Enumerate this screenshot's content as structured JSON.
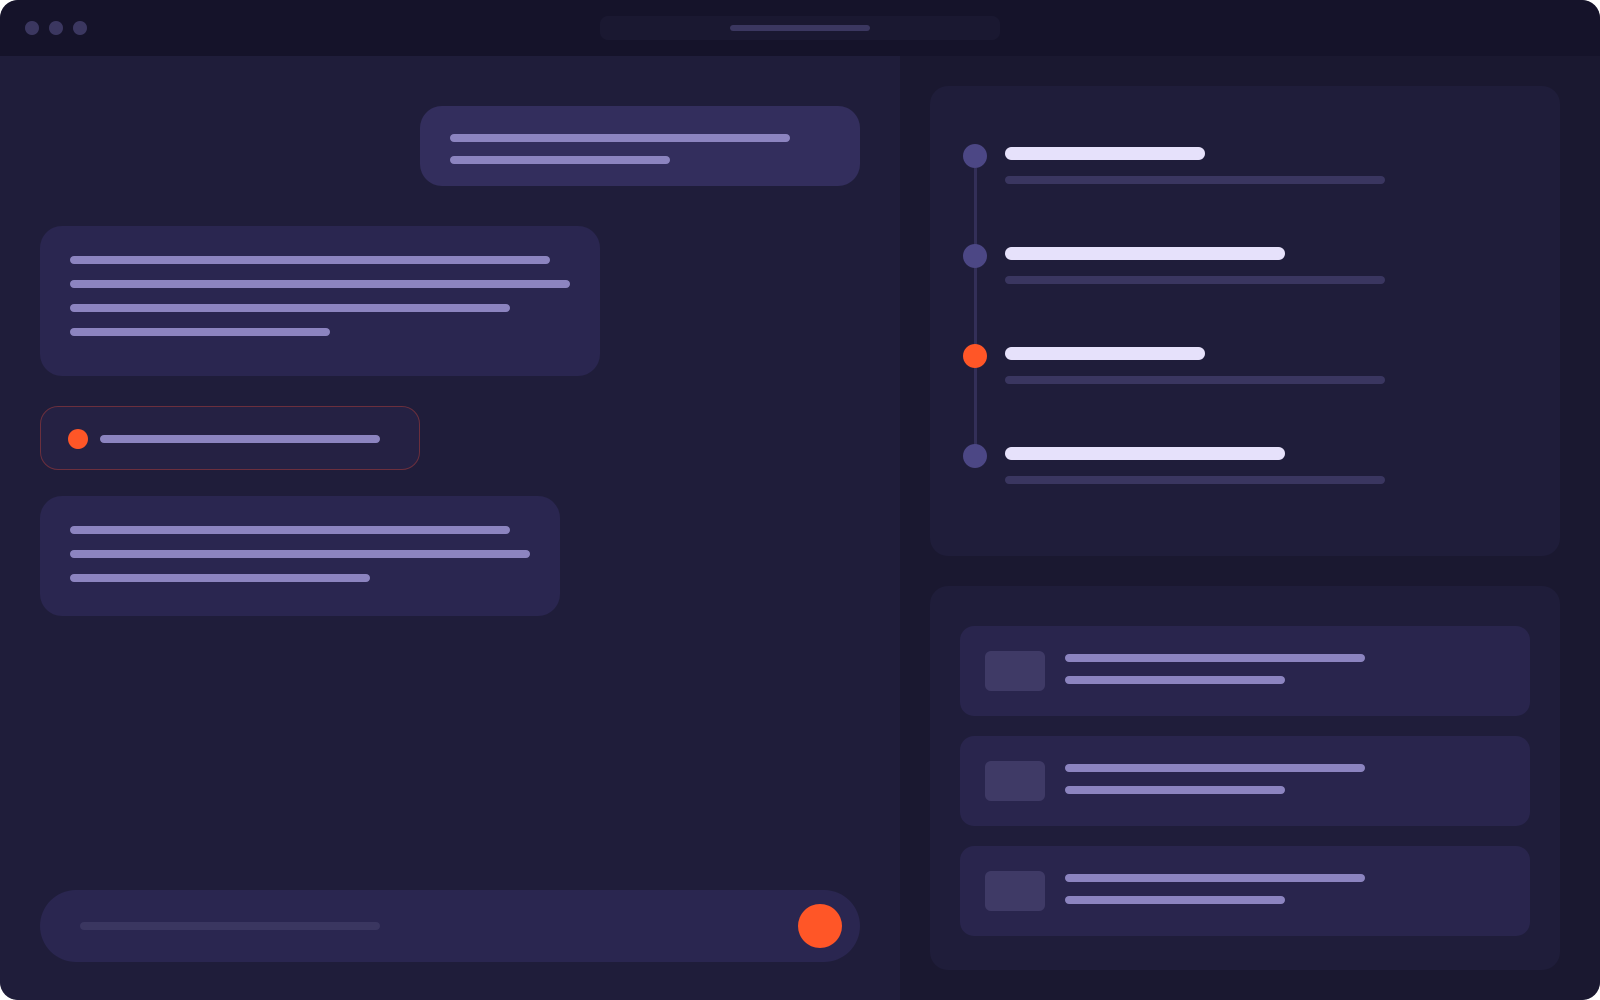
{
  "window": {
    "title": ""
  },
  "colors": {
    "accent": "#ff5627",
    "background": "#1e1c37",
    "panel": "#1f1d3a",
    "bubble": "#2a2650",
    "text_placeholder": "#8c84c0",
    "timeline_node": "#4c4785"
  },
  "chat": {
    "messages": [
      {
        "role": "user",
        "text": ""
      },
      {
        "role": "assistant",
        "text": ""
      },
      {
        "role": "status",
        "text": ""
      },
      {
        "role": "assistant",
        "text": ""
      }
    ],
    "composer": {
      "placeholder": "",
      "send_icon": "send-icon"
    }
  },
  "timeline": {
    "steps": [
      {
        "title": "",
        "detail": "",
        "state": "done"
      },
      {
        "title": "",
        "detail": "",
        "state": "done"
      },
      {
        "title": "",
        "detail": "",
        "state": "active"
      },
      {
        "title": "",
        "detail": "",
        "state": "pending"
      }
    ]
  },
  "files": {
    "items": [
      {
        "name": "",
        "meta": "",
        "icon": "file-thumbnail-icon"
      },
      {
        "name": "",
        "meta": "",
        "icon": "file-thumbnail-icon"
      },
      {
        "name": "",
        "meta": "",
        "icon": "file-thumbnail-icon"
      }
    ]
  }
}
